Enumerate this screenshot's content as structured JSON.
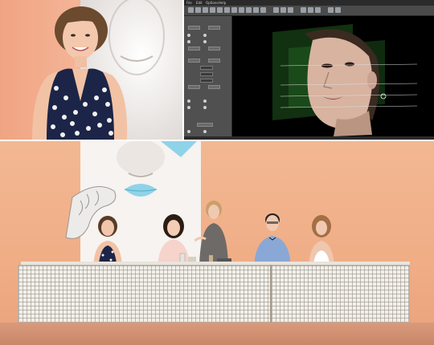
{
  "app": {
    "menu": [
      "File",
      "Edit",
      "Options",
      "Help"
    ],
    "panel_buttons": [
      "",
      "",
      "",
      "",
      "",
      "",
      "",
      ""
    ]
  },
  "colors": {
    "backdrop": "#f0ad86",
    "app_background": "#3b3b3b",
    "viewport_background": "#000000",
    "lips_blue": "#8fd3e8"
  }
}
